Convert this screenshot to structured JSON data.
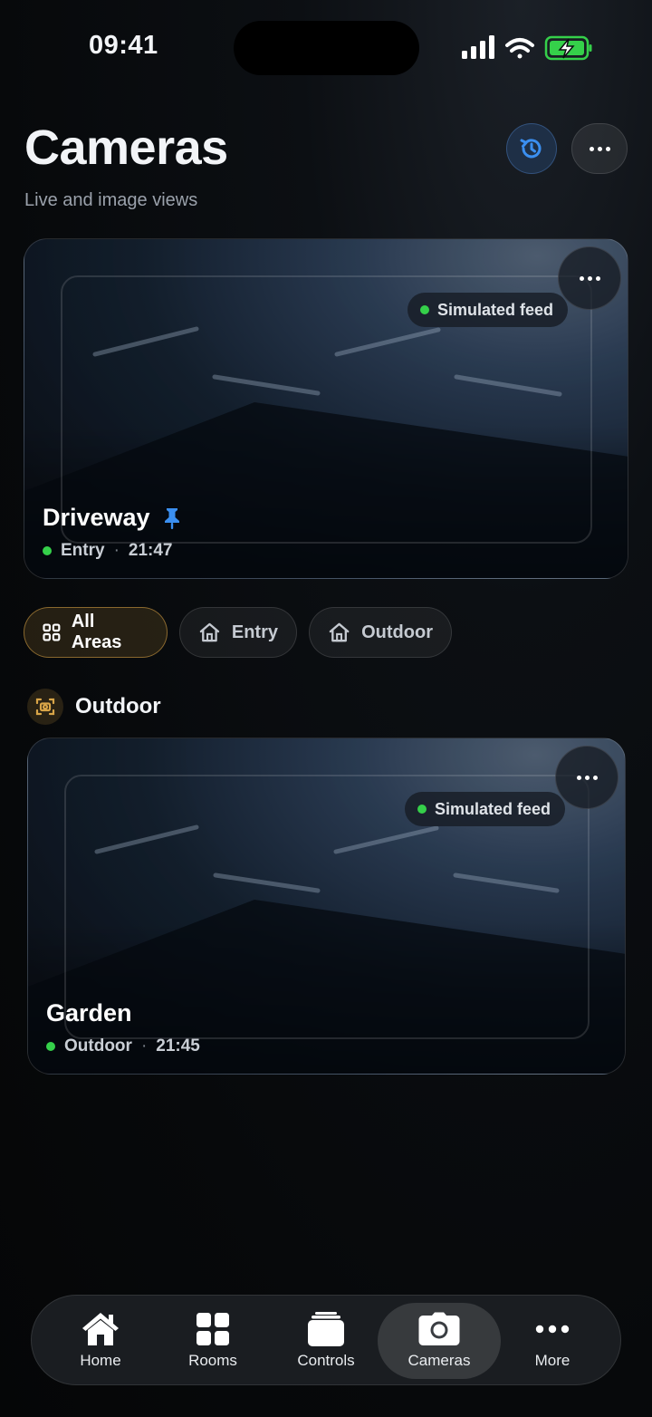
{
  "status_bar": {
    "time": "09:41"
  },
  "header": {
    "title": "Cameras",
    "subtitle": "Live and image views"
  },
  "featured_camera": {
    "name": "Driveway",
    "feed_label": "Simulated feed",
    "area": "Entry",
    "separator": "·",
    "timestamp": "21:47",
    "pinned": true
  },
  "filters": [
    {
      "label": "All Areas",
      "active": true
    },
    {
      "label": "Entry",
      "active": false
    },
    {
      "label": "Outdoor",
      "active": false
    }
  ],
  "section": {
    "title": "Outdoor",
    "cameras": [
      {
        "name": "Garden",
        "feed_label": "Simulated feed",
        "area": "Outdoor",
        "separator": "·",
        "timestamp": "21:45"
      }
    ]
  },
  "tabbar": {
    "items": [
      {
        "label": "Home"
      },
      {
        "label": "Rooms"
      },
      {
        "label": "Controls"
      },
      {
        "label": "Cameras",
        "active": true
      },
      {
        "label": "More"
      }
    ]
  },
  "colors": {
    "accent_blue": "#3b8ff0",
    "live_green": "#35d04a",
    "chip_gold": "#d8a548"
  }
}
